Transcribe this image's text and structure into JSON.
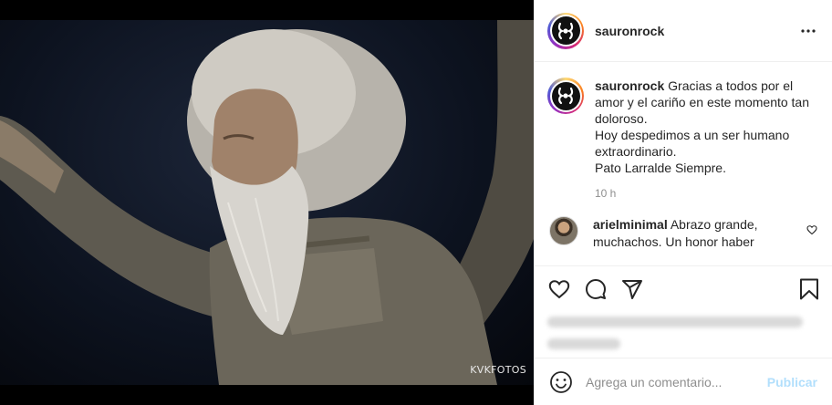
{
  "photo": {
    "watermark": "KVKFOTOS"
  },
  "header": {
    "username": "sauronrock",
    "avatar_icon": "sauron-band-logo",
    "more_icon": "more-horizontal-icon"
  },
  "caption": {
    "username": "sauronrock",
    "lines": [
      "Gracias a todos por el amor y el cariño en este momento tan doloroso.",
      "Hoy despedimos a un ser humano extraordinario.",
      "Pato Larralde Siempre."
    ],
    "time": "10 h"
  },
  "comments": [
    {
      "username": "arielminimal",
      "text": "Abrazo grande, muchachos. Un honor haber"
    }
  ],
  "actions": {
    "like_icon": "heart-icon",
    "comment_icon": "comment-bubble-icon",
    "share_icon": "paper-plane-icon",
    "save_icon": "bookmark-icon"
  },
  "add_comment": {
    "placeholder": "Agrega un comentario...",
    "publish_label": "Publicar",
    "emoji_icon": "emoji-smile-icon"
  },
  "colors": {
    "accent_disabled": "#b2dffc",
    "text_primary": "#262626",
    "text_secondary": "#8e8e8e",
    "divider": "#efefef"
  }
}
